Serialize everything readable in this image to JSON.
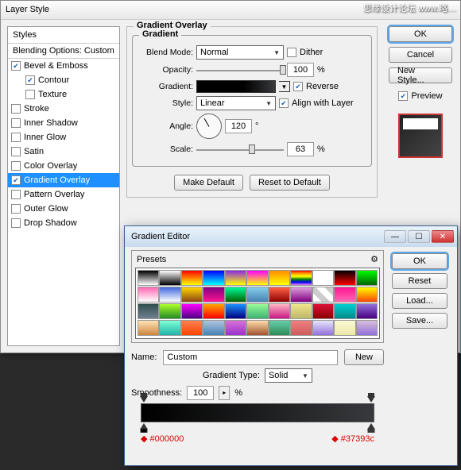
{
  "watermark": "思缘设计论坛    www.略…",
  "layerStyle": {
    "title": "Layer Style",
    "stylesHeader": "Styles",
    "blendingOptions": "Blending Options: Custom",
    "items": [
      {
        "label": "Bevel & Emboss",
        "checked": true,
        "indent": false
      },
      {
        "label": "Contour",
        "checked": true,
        "indent": true
      },
      {
        "label": "Texture",
        "checked": false,
        "indent": true
      },
      {
        "label": "Stroke",
        "checked": false,
        "indent": false
      },
      {
        "label": "Inner Shadow",
        "checked": false,
        "indent": false
      },
      {
        "label": "Inner Glow",
        "checked": false,
        "indent": false
      },
      {
        "label": "Satin",
        "checked": false,
        "indent": false
      },
      {
        "label": "Color Overlay",
        "checked": false,
        "indent": false
      },
      {
        "label": "Gradient Overlay",
        "checked": true,
        "indent": false,
        "selected": true
      },
      {
        "label": "Pattern Overlay",
        "checked": false,
        "indent": false
      },
      {
        "label": "Outer Glow",
        "checked": false,
        "indent": false
      },
      {
        "label": "Drop Shadow",
        "checked": false,
        "indent": false
      }
    ],
    "section": "Gradient Overlay",
    "subsection": "Gradient",
    "blendModeLabel": "Blend Mode:",
    "blendMode": "Normal",
    "dither": "Dither",
    "ditherChecked": false,
    "opacityLabel": "Opacity:",
    "opacity": "100",
    "pct": "%",
    "gradientLabel": "Gradient:",
    "reverse": "Reverse",
    "reverseChecked": true,
    "styleLabel": "Style:",
    "style": "Linear",
    "align": "Align with Layer",
    "alignChecked": true,
    "angleLabel": "Angle:",
    "angle": "120",
    "deg": "°",
    "scaleLabel": "Scale:",
    "scale": "63",
    "makeDefault": "Make Default",
    "resetDefault": "Reset to Default",
    "ok": "OK",
    "cancel": "Cancel",
    "newStyle": "New Style...",
    "previewLabel": "Preview",
    "previewChecked": true
  },
  "gradEditor": {
    "title": "Gradient Editor",
    "presets": "Presets",
    "name": "Name:",
    "nameValue": "Custom",
    "newBtn": "New",
    "gradTypeLabel": "Gradient Type:",
    "gradType": "Solid",
    "smoothLabel": "Smoothness:",
    "smoothness": "100",
    "pct": "%",
    "ok": "OK",
    "reset": "Reset",
    "load": "Load...",
    "save": "Save...",
    "hex1": "#000000",
    "hex2": "#37393c"
  },
  "swatches": [
    "linear-gradient(#000,#fff)",
    "linear-gradient(#fff,#000)",
    "linear-gradient(#f00,#ff0)",
    "linear-gradient(#00f,#0ff)",
    "linear-gradient(#8a2be2,#ff0)",
    "linear-gradient(#f0f,#ff0)",
    "linear-gradient(#ff8c00,#ff0)",
    "linear-gradient(red,orange,yellow,green,blue,violet)",
    "linear-gradient(#fff,transparent)",
    "linear-gradient(#000,#f00)",
    "linear-gradient(#0f0,#006400)",
    "linear-gradient(#ff69b4,#fff)",
    "linear-gradient(#4169e1,#fff)",
    "linear-gradient(#ffd700,#8b4513)",
    "linear-gradient(#800080,#ff1493)",
    "linear-gradient(#00fa9a,#006400)",
    "linear-gradient(#87ceeb,#4682b4)",
    "linear-gradient(#ff6347,#8b0000)",
    "linear-gradient(#dda0dd,#800080)",
    "linear-gradient(45deg,#fff 25%,#ccc 25%,#ccc 50%,#fff 50%,#fff 75%,#ccc 75%)",
    "linear-gradient(#ff1493,#ff69b4)",
    "linear-gradient(#ff0,#ff4500)",
    "linear-gradient(#2f4f4f,#708090)",
    "linear-gradient(#adff2f,#228b22)",
    "linear-gradient(#ff00ff,#4b0082)",
    "linear-gradient(#ffa500,#ff0000)",
    "linear-gradient(#1e90ff,#000080)",
    "linear-gradient(#98fb98,#3cb371)",
    "linear-gradient(#ffb6c1,#c71585)",
    "linear-gradient(#f0e68c,#bdb76b)",
    "linear-gradient(#dc143c,#8b0000)",
    "linear-gradient(#00ced1,#008b8b)",
    "linear-gradient(#9370db,#4b0082)",
    "linear-gradient(#ffe4b5,#cd853f)",
    "linear-gradient(#7fffd4,#20b2aa)",
    "linear-gradient(#ff7f50,#ff4500)",
    "linear-gradient(#b0c4de,#4682b4)",
    "linear-gradient(#da70d6,#9932cc)",
    "linear-gradient(#ffdead,#a0522d)",
    "linear-gradient(#66cdaa,#2e8b57)",
    "linear-gradient(#f08080,#cd5c5c)",
    "linear-gradient(#e6e6fa,#9370db)",
    "linear-gradient(#fafad2,#eee8aa)",
    "linear-gradient(#d8bfd8,#9370db)"
  ]
}
